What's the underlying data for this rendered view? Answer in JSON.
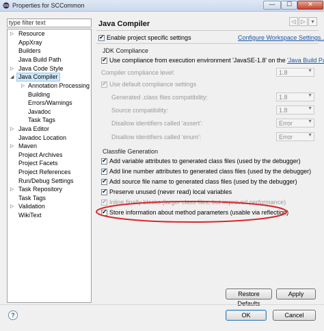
{
  "window": {
    "title": "Properties for SCCommon",
    "minimize_glyph": "—",
    "maximize_glyph": "☐",
    "close_glyph": "✕"
  },
  "sidebar": {
    "filter_placeholder": "type filter text",
    "items": [
      {
        "label": "Resource"
      },
      {
        "label": "AppXray"
      },
      {
        "label": "Builders"
      },
      {
        "label": "Java Build Path"
      },
      {
        "label": "Java Code Style"
      },
      {
        "label": "Java Compiler"
      },
      {
        "label": "Annotation Processing"
      },
      {
        "label": "Building"
      },
      {
        "label": "Errors/Warnings"
      },
      {
        "label": "Javadoc"
      },
      {
        "label": "Task Tags"
      },
      {
        "label": "Java Editor"
      },
      {
        "label": "Javadoc Location"
      },
      {
        "label": "Maven"
      },
      {
        "label": "Project Archives"
      },
      {
        "label": "Project Facets"
      },
      {
        "label": "Project References"
      },
      {
        "label": "Run/Debug Settings"
      },
      {
        "label": "Task Repository"
      },
      {
        "label": "Task Tags"
      },
      {
        "label": "Validation"
      },
      {
        "label": "WikiText"
      }
    ],
    "arrow_expanded": "◢",
    "arrow_collapsed": "▷"
  },
  "main": {
    "title": "Java Compiler",
    "nav_back_glyph": "◁",
    "nav_fwd_glyph": "▷",
    "nav_menu_glyph": "▾",
    "enable_specific": "Enable project specific settings",
    "configure_link": "Configure Workspace Settings...",
    "jdk": {
      "group_title": "JDK Compliance",
      "use_compliance_prefix": "Use compliance from execution environment 'JavaSE-1.8' on the ",
      "use_compliance_link": "'Java Build Path'",
      "compiler_level_label": "Compiler compliance level:",
      "compiler_level_value": "1.8",
      "use_default": "Use default compliance settings",
      "generated_label": "Generated .class files compatibility:",
      "generated_value": "1.8",
      "source_label": "Source compatibility:",
      "source_value": "1.8",
      "assert_label": "Disallow identifiers called 'assert':",
      "assert_value": "Error",
      "enum_label": "Disallow identifiers called 'enum':",
      "enum_value": "Error",
      "combo_arrow": "▼"
    },
    "classfile": {
      "group_title": "Classfile Generation",
      "opt_variable": "Add variable attributes to generated class files (used by the debugger)",
      "opt_line": "Add line number attributes to generated class files (used by the debugger)",
      "opt_source": "Add source file name to generated class files (used by the debugger)",
      "opt_preserve": "Preserve unused (never read) local variables",
      "opt_inline": "Inline finally blocks (larger class files, but improved performance)",
      "opt_store": "Store information about method parameters (usable via reflection)"
    },
    "restore_defaults": "Restore Defaults",
    "apply": "Apply"
  },
  "footer": {
    "help_glyph": "?",
    "ok": "OK",
    "cancel": "Cancel"
  },
  "colors": {
    "highlight_ellipse": "#d8262b",
    "selection": "#cde8ff",
    "link": "#1a55a3"
  }
}
